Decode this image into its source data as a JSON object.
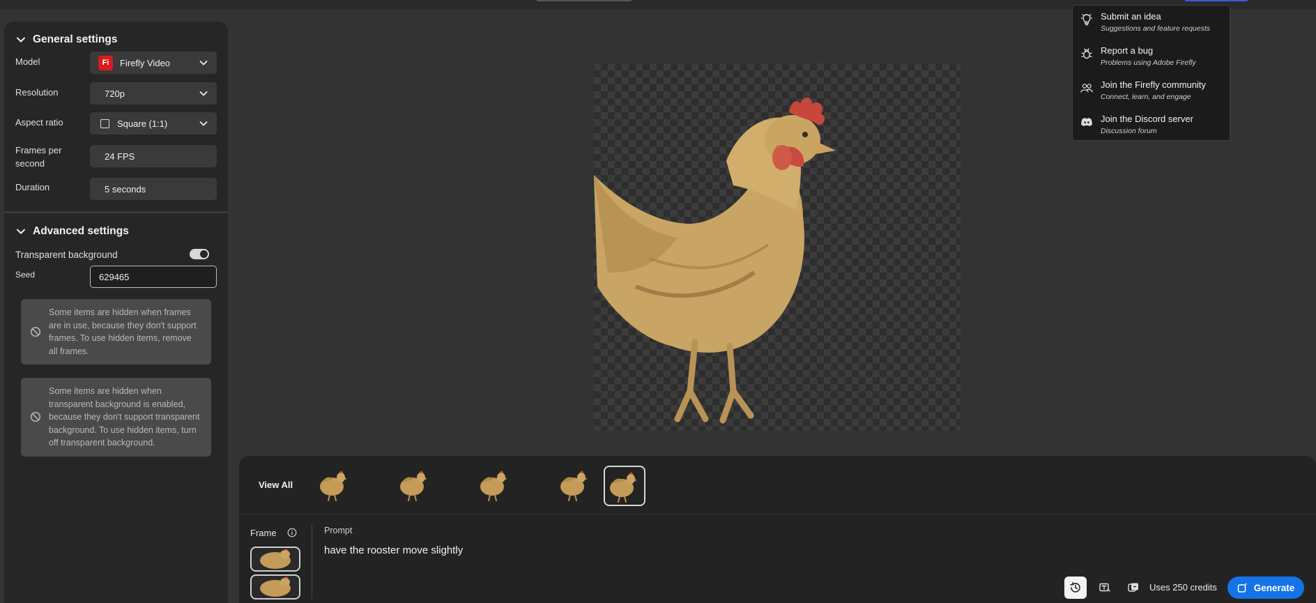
{
  "general_settings": {
    "title": "General settings",
    "model": {
      "label": "Model",
      "value": "Firefly Video",
      "badge": "Fi"
    },
    "resolution": {
      "label": "Resolution",
      "value": "720p"
    },
    "aspect_ratio": {
      "label": "Aspect ratio",
      "value": "Square (1:1)"
    },
    "fps": {
      "label_line1": "Frames per",
      "label_line2": "second",
      "value": "24 FPS"
    },
    "duration": {
      "label": "Duration",
      "value": "5 seconds"
    }
  },
  "advanced_settings": {
    "title": "Advanced settings",
    "transparent_background": {
      "label": "Transparent background",
      "enabled": true
    },
    "seed": {
      "label": "Seed",
      "value": "629465"
    },
    "notice_frames": "Some items are hidden when frames are in use, because they don't support frames. To use hidden items, remove all frames.",
    "notice_transparent": "Some items are hidden when transparent background is enabled, because they don't support transparent background. To use hidden items, turn off transparent background."
  },
  "help_menu": {
    "items": [
      {
        "title": "Submit an idea",
        "subtitle": "Suggestions and feature requests",
        "icon": "lightbulb-icon"
      },
      {
        "title": "Report a bug",
        "subtitle": "Problems using Adobe Firefly",
        "icon": "bug-icon"
      },
      {
        "title": "Join the Firefly community",
        "subtitle": "Connect, learn, and engage",
        "icon": "community-icon"
      },
      {
        "title": "Join the Discord server",
        "subtitle": "Discussion forum",
        "icon": "discord-icon"
      }
    ]
  },
  "gallery": {
    "view_all": "View All",
    "thumbnail_count": 5,
    "selected_index": 4
  },
  "composer": {
    "frame_label": "Frame",
    "prompt_label": "Prompt",
    "prompt_text": "have the rooster move slightly",
    "credits": "Uses 250 credits",
    "generate_label": "Generate"
  },
  "colors": {
    "accent": "#1473e6",
    "model_badge": "#d91b1b",
    "background": "#333333",
    "panel": "#262626"
  }
}
